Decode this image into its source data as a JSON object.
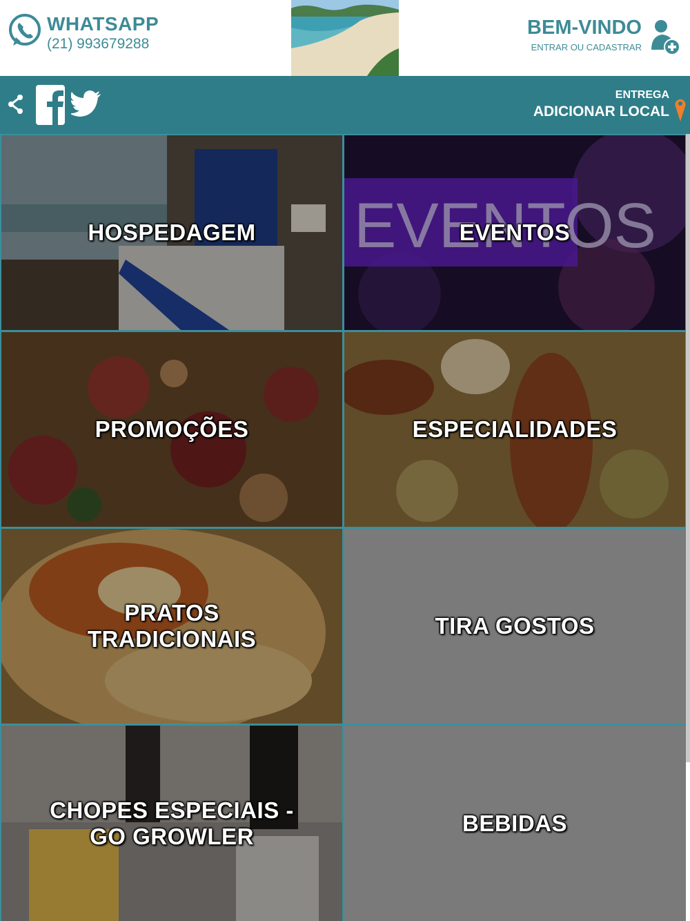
{
  "header": {
    "whatsapp_title": "WHATSAPP",
    "whatsapp_phone": "(21) 993679288",
    "welcome_title": "BEM-VINDO",
    "welcome_sub": "ENTRAR OU CADASTRAR"
  },
  "bar": {
    "delivery_small": "ENTREGA",
    "delivery_big": "ADICIONAR LOCAL"
  },
  "tiles": [
    {
      "label": "HOSPEDAGEM"
    },
    {
      "label": "EVENTOS"
    },
    {
      "label": "PROMOÇÕES"
    },
    {
      "label": "ESPECIALIDADES"
    },
    {
      "label": "PRATOS TRADICIONAIS"
    },
    {
      "label": "TIRA GOSTOS"
    },
    {
      "label": "CHOPES ESPECIAIS - GO GROWLER"
    },
    {
      "label": "BEBIDAS"
    }
  ],
  "colors": {
    "teal": "#2f7d88",
    "teal_text": "#3d8b96",
    "grey_tile": "#7a7a7a",
    "pin_orange": "#f07f2a"
  },
  "icons": [
    "whatsapp-icon",
    "share-icon",
    "facebook-icon",
    "twitter-icon",
    "user-add-icon",
    "location-pin-icon"
  ]
}
